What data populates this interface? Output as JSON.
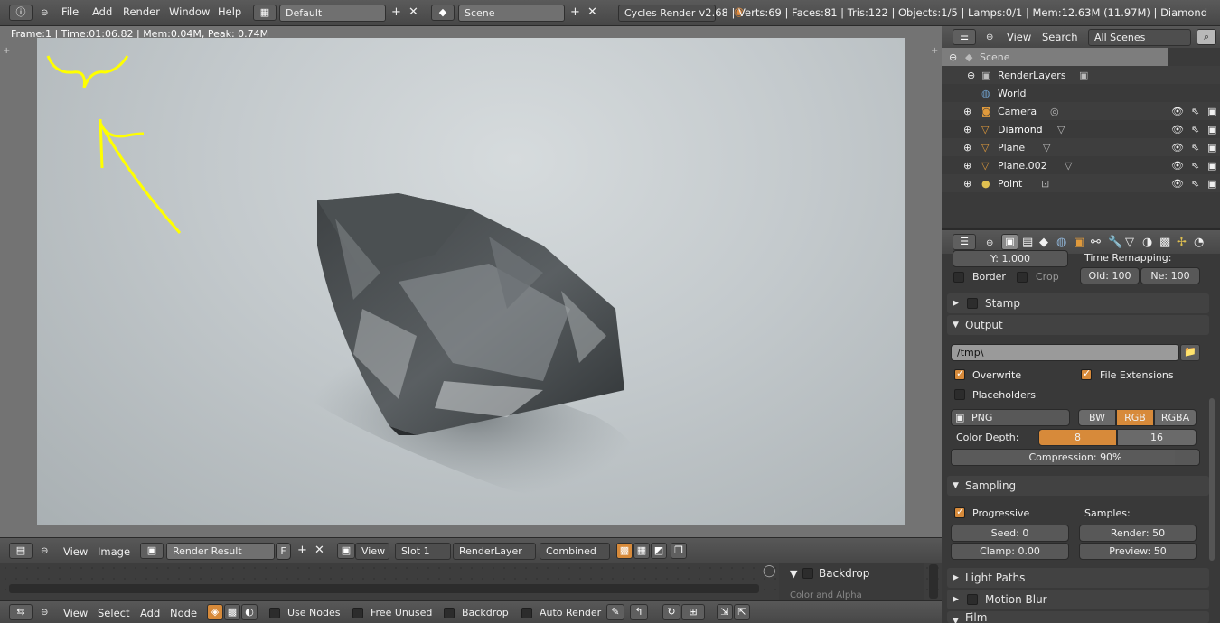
{
  "topbar": {
    "menus": [
      "File",
      "Add",
      "Render",
      "Window",
      "Help"
    ],
    "screen_layout": "Default",
    "scene": "Scene",
    "render_engine": "Cycles Render",
    "stats": "v2.68 | Verts:69 | Faces:81 | Tris:122 | Objects:1/5 | Lamps:0/1 | Mem:12.63M (11.97M) | Diamond"
  },
  "viewport": {
    "frame_info": "Frame:1 | Time:01:06.82 | Mem:0.04M, Peak: 0.74M"
  },
  "image_editor_footer": {
    "view": "View",
    "image": "Image",
    "image_name": "Render Result",
    "fake_user": "F",
    "view_dropdown": "View",
    "slot": "Slot 1",
    "layer": "RenderLayer",
    "pass": "Combined"
  },
  "node_editor_footer": {
    "view": "View",
    "select": "Select",
    "add": "Add",
    "node": "Node",
    "use_nodes": "Use Nodes",
    "free_unused": "Free Unused",
    "backdrop": "Backdrop",
    "auto_render": "Auto Render"
  },
  "node_sidebar": {
    "backdrop": "Backdrop",
    "color_alpha": "Color and Alpha"
  },
  "outliner": {
    "view": "View",
    "search": "Search",
    "filter": "All Scenes",
    "items": [
      {
        "label": "Scene"
      },
      {
        "label": "RenderLayers"
      },
      {
        "label": "World"
      },
      {
        "label": "Camera"
      },
      {
        "label": "Diamond"
      },
      {
        "label": "Plane"
      },
      {
        "label": "Plane.002"
      },
      {
        "label": "Point"
      }
    ]
  },
  "properties": {
    "y_value": "Y: 1.000",
    "time_remapping": "Time Remapping:",
    "border": "Border",
    "crop": "Crop",
    "old": "Old: 100",
    "new": "Ne: 100",
    "stamp": "Stamp",
    "output": "Output",
    "output_path": "/tmp\\",
    "overwrite": "Overwrite",
    "file_extensions": "File Extensions",
    "placeholders": "Placeholders",
    "file_format": "PNG",
    "bw": "BW",
    "rgb": "RGB",
    "rgba": "RGBA",
    "color_depth_label": "Color Depth:",
    "depth_8": "8",
    "depth_16": "16",
    "compression": "Compression: 90%",
    "compression_value": 0.9,
    "sampling": "Sampling",
    "progressive": "Progressive",
    "samples_label": "Samples:",
    "seed": "Seed: 0",
    "render_samples": "Render: 50",
    "clamp": "Clamp: 0.00",
    "preview_samples": "Preview: 50",
    "light_paths": "Light Paths",
    "motion_blur": "Motion Blur",
    "film": "Film"
  },
  "colors": {
    "accent": "#d78a3a",
    "annotation": "#ffff00"
  }
}
